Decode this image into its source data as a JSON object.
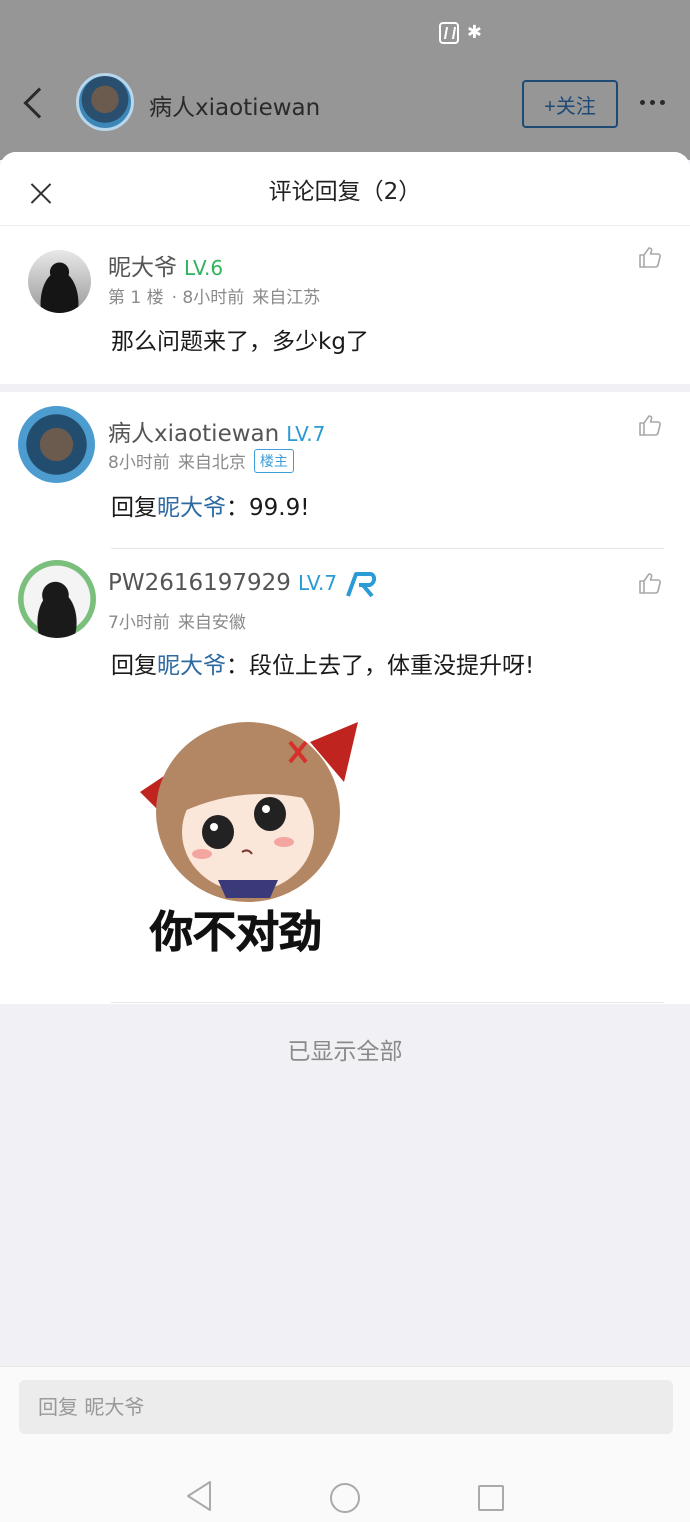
{
  "status_bar": {
    "icons": [
      "nfc-icon",
      "bluetooth-icon"
    ]
  },
  "background_header": {
    "username": "病人xiaotiewan",
    "follow_label": "+关注"
  },
  "sheet": {
    "title": "评论回复（2）",
    "main_comment": {
      "name": "昵大爷",
      "level": "LV.6",
      "floor": "第 1 楼",
      "time": "· 8小时前",
      "location": "来自江苏",
      "text": "那么问题来了，多少kg了"
    },
    "replies": [
      {
        "name": "病人xiaotiewan",
        "level": "LV.7",
        "time": "8小时前",
        "location": "来自北京",
        "tag": "楼主",
        "reply_prefix": "回复",
        "mention": "昵大爷",
        "text": "：99.9!"
      },
      {
        "name": "PW2616197929",
        "level": "LV.7",
        "time": "7小时前",
        "location": "来自安徽",
        "reply_prefix": "回复",
        "mention": "昵大爷",
        "text": "：段位上去了，体重没提升呀!",
        "sticker_caption": "你不对劲"
      }
    ],
    "all_shown": "已显示全部",
    "reply_placeholder": "回复 昵大爷"
  },
  "colors": {
    "level_green": "#2fb35c",
    "level_blue": "#2a9bd4",
    "mention": "#2d6aa0",
    "follow_border": "#1e4b76"
  }
}
